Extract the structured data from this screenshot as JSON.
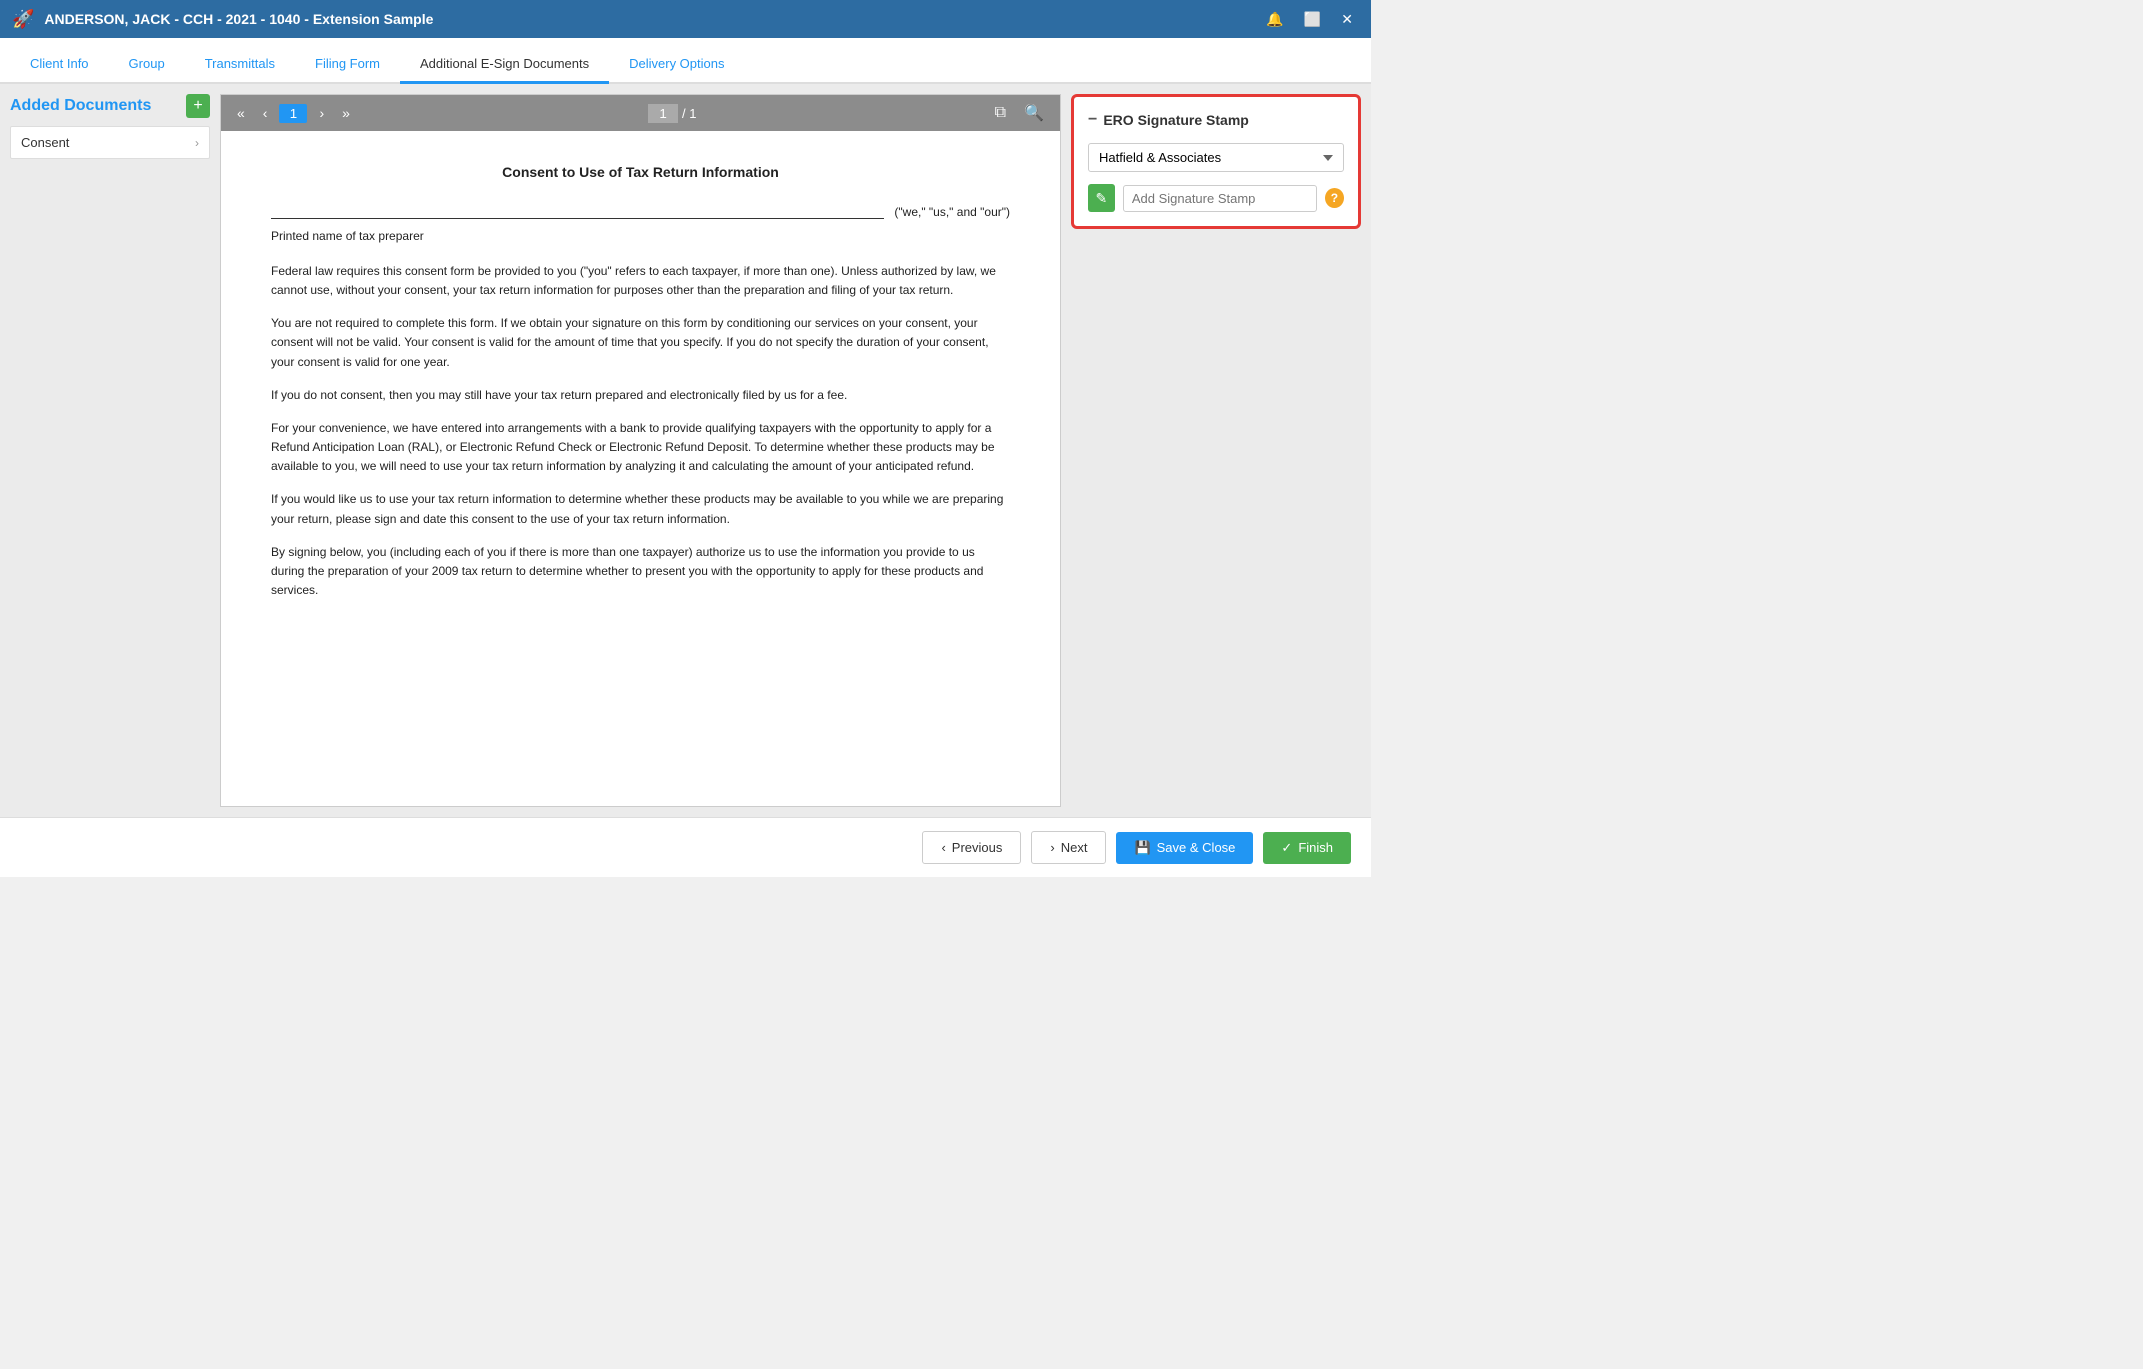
{
  "titlebar": {
    "title": "ANDERSON, JACK - CCH - 2021 - 1040 - Extension Sample",
    "icon": "🚀"
  },
  "tabs": [
    {
      "label": "Client Info",
      "active": false
    },
    {
      "label": "Group",
      "active": false
    },
    {
      "label": "Transmittals",
      "active": false
    },
    {
      "label": "Filing Form",
      "active": false
    },
    {
      "label": "Additional E-Sign Documents",
      "active": true
    },
    {
      "label": "Delivery Options",
      "active": false
    }
  ],
  "left_panel": {
    "title": "Added Documents",
    "add_btn_label": "+",
    "documents": [
      {
        "name": "Consent"
      }
    ]
  },
  "doc_viewer": {
    "current_page": "1",
    "total_pages": "1",
    "page_input": "1",
    "document": {
      "title": "Consent to Use of Tax Return Information",
      "line_label": "(\"we,\" \"us,\" and \"our\")",
      "printed_name": "Printed name of tax preparer",
      "paragraphs": [
        "Federal law requires this consent form be provided to you (\"you\" refers to each taxpayer, if more than one). Unless authorized by law, we cannot use, without your consent, your tax return information for purposes other than the preparation and filing of your tax return.",
        "You are not required to complete this form. If we obtain your signature on this form by conditioning our services on your consent, your consent will not be valid. Your consent is valid for the amount of time that you specify. If you do not specify the duration of your consent, your consent is valid for one year.",
        "If you do not consent, then you may still have your tax return prepared and electronically filed by us for a fee.",
        "For your convenience, we have entered into arrangements with a bank to provide qualifying taxpayers with the opportunity to apply for a Refund Anticipation Loan (RAL), or Electronic Refund Check or Electronic Refund Deposit. To determine whether these products may be available to you, we will need to use your tax return information by analyzing it and calculating the amount of your anticipated refund.",
        "If you would like us to use your tax return information to determine whether these products may be available to you while we are preparing your return, please sign and date this consent to the use of your tax return information.",
        "By signing below, you (including each of you if there is more than one taxpayer) authorize us to use the information you provide to us during the preparation of your 2009 tax return to determine whether to present you with the opportunity to apply for these products and services."
      ]
    }
  },
  "ero_panel": {
    "header": "ERO Signature Stamp",
    "dropdown_value": "Hatfield & Associates",
    "dropdown_options": [
      "Hatfield & Associates"
    ],
    "signature_placeholder": "Add Signature Stamp",
    "help_icon": "?"
  },
  "footer": {
    "previous_label": "Previous",
    "next_label": "Next",
    "save_close_label": "Save & Close",
    "finish_label": "Finish"
  }
}
